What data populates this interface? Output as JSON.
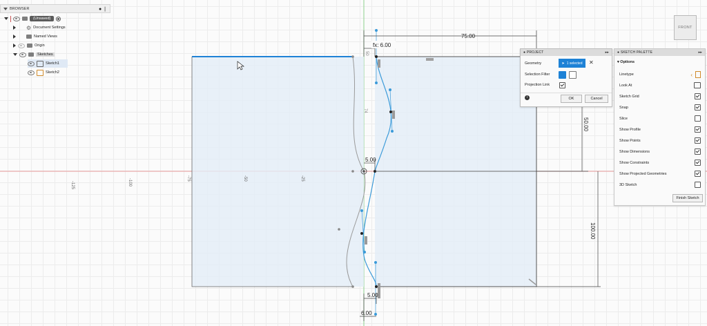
{
  "browser": {
    "title": "BROWSER",
    "doc_name": "(Unsaved)",
    "items": [
      {
        "label": "Document Settings"
      },
      {
        "label": "Named Views"
      },
      {
        "label": "Origin"
      },
      {
        "label": "Sketches"
      },
      {
        "label": "Sketch1"
      },
      {
        "label": "Sketch2"
      }
    ]
  },
  "viewcube": {
    "label": "FRONT"
  },
  "dimensions": {
    "width_top": "75.00",
    "fx_label": "fx: 6.00",
    "height_right": "50.00",
    "mid_offset": "5.00",
    "height_total": "100.00",
    "bottom_offset": "5.00",
    "bottom_width": "6.00",
    "small_top": "50",
    "small_mid": "74"
  },
  "axis_ticks": [
    "-125",
    "-100",
    "-75",
    "-50",
    "-25"
  ],
  "project_dialog": {
    "title": "PROJECT",
    "geometry_label": "Geometry",
    "geometry_value": "1 selected",
    "selection_filter_label": "Selection Filter",
    "projection_link_label": "Projection Link",
    "ok": "OK",
    "cancel": "Cancel"
  },
  "sketch_palette": {
    "title": "SKETCH PALETTE",
    "section": "Options",
    "options": [
      {
        "label": "Linetype",
        "control": "linetype"
      },
      {
        "label": "Look At",
        "control": "lookat"
      },
      {
        "label": "Sketch Grid",
        "control": "check",
        "checked": true
      },
      {
        "label": "Snap",
        "control": "check",
        "checked": true
      },
      {
        "label": "Slice",
        "control": "check",
        "checked": false
      },
      {
        "label": "Show Profile",
        "control": "check",
        "checked": true
      },
      {
        "label": "Show Points",
        "control": "check",
        "checked": true
      },
      {
        "label": "Show Dimensions",
        "control": "check",
        "checked": true
      },
      {
        "label": "Show Constraints",
        "control": "check",
        "checked": true
      },
      {
        "label": "Show Projected Geometries",
        "control": "check",
        "checked": true
      },
      {
        "label": "3D Sketch",
        "control": "check",
        "checked": false
      }
    ],
    "finish_button": "Finish Sketch"
  },
  "colors": {
    "accent": "#1e82d6",
    "sketch_blue": "#3a9ad9",
    "profile_fill": "#e3eef8",
    "axis_red": "#e89a9a",
    "axis_green": "#8ed08e"
  }
}
